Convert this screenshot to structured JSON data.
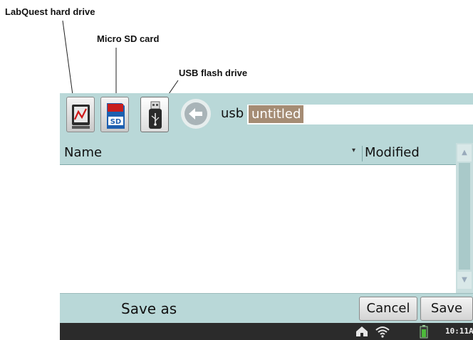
{
  "callouts": {
    "labquest": "LabQuest hard drive",
    "sd": "Micro SD card",
    "usb": "USB flash drive"
  },
  "toolbar": {
    "path": "usb",
    "filename": "untitled"
  },
  "columns": {
    "name": "Name",
    "modified": "Modified"
  },
  "footer": {
    "label": "Save as",
    "cancel": "Cancel",
    "save": "Save"
  },
  "status": {
    "clock": "10:11A"
  },
  "icons": {
    "labquest_drive": "labquest-drive-icon",
    "sd_card": "sd-card-icon",
    "usb_drive": "usb-drive-icon",
    "back": "back-arrow-icon",
    "home": "home-icon",
    "wifi": "wifi-icon",
    "battery": "battery-icon"
  },
  "colors": {
    "panel": "#b9d8d8",
    "selection": "#a58c74",
    "statusbar": "#2b2b2b",
    "sd_blue": "#1d5fb0"
  }
}
